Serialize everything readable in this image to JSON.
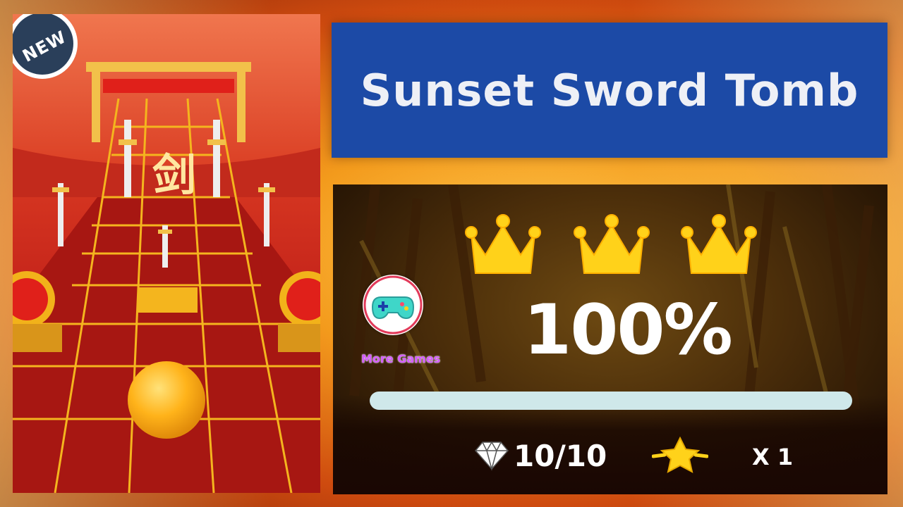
{
  "badge": {
    "text": "NEW"
  },
  "level": {
    "title": "Sunset Sword Tomb"
  },
  "result": {
    "crowns_earned": 3,
    "crowns_total": 3,
    "percent_text": "100%",
    "progress": 1.0,
    "gems_text": "10/10",
    "stars_multiplier": "X 1"
  },
  "sidebar": {
    "more_games_label": "More Games"
  },
  "icons": {
    "crown": "crown-icon",
    "gem": "diamond-icon",
    "star": "star-icon",
    "more_games": "gamepad-icon",
    "sword": "sword-icon",
    "ball": "ball"
  },
  "colors": {
    "title_bar": "#1c4aa6",
    "crown_gold": "#ffd21a",
    "progress_fill": "#cfe8ea",
    "more_games_text": "#d35bff",
    "ball": "#ffb31a",
    "tile_line": "#f4b51e"
  }
}
